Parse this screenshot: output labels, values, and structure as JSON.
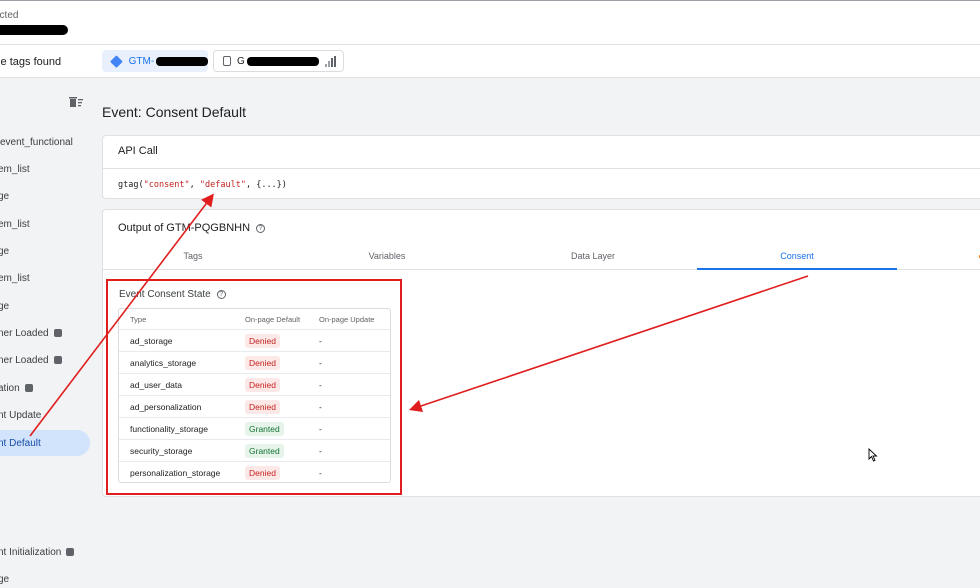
{
  "header": {
    "connection_label": "ected"
  },
  "tags_bar": {
    "found_label": "gle tags found",
    "gtm_chip_label": "GTM-",
    "ga_chip_label": "G"
  },
  "sidebar": {
    "items": [
      {
        "label": "event_functional"
      },
      {
        "label": "em_list"
      },
      {
        "label": "ge"
      },
      {
        "label": "em_list"
      },
      {
        "label": "ge"
      },
      {
        "label": "em_list"
      },
      {
        "label": "ge"
      },
      {
        "label": "ner Loaded"
      },
      {
        "label": "ner Loaded"
      },
      {
        "label": "ation"
      },
      {
        "label": "nt Update"
      },
      {
        "label": "nt Default"
      },
      {
        "label": "nt Initialization"
      },
      {
        "label": "ge"
      }
    ]
  },
  "main": {
    "title": "Event: Consent Default",
    "api_card": {
      "heading": "API Call",
      "code_prefix": "gtag(",
      "code_arg1": "\"consent\"",
      "code_sep": ", ",
      "code_arg2": "\"default\"",
      "code_suffix": ", {...})"
    },
    "output_card": {
      "heading": "Output of GTM-PQGBNHN",
      "tabs": [
        {
          "label": "Tags"
        },
        {
          "label": "Variables"
        },
        {
          "label": "Data Layer"
        },
        {
          "label": "Consent"
        }
      ],
      "consent_state_title": "Event Consent State",
      "table": {
        "headers": [
          "Type",
          "On-page Default",
          "On-page Update"
        ],
        "rows": [
          {
            "type": "ad_storage",
            "default": "Denied",
            "update": "-"
          },
          {
            "type": "analytics_storage",
            "default": "Denied",
            "update": "-"
          },
          {
            "type": "ad_user_data",
            "default": "Denied",
            "update": "-"
          },
          {
            "type": "ad_personalization",
            "default": "Denied",
            "update": "-"
          },
          {
            "type": "functionality_storage",
            "default": "Granted",
            "update": "-"
          },
          {
            "type": "security_storage",
            "default": "Granted",
            "update": "-"
          },
          {
            "type": "personalization_storage",
            "default": "Denied",
            "update": "-"
          }
        ]
      }
    }
  },
  "colors": {
    "accent": "#1a73e8",
    "denied": "#c5221f",
    "granted": "#137333",
    "annotation": "#e01e1e"
  }
}
